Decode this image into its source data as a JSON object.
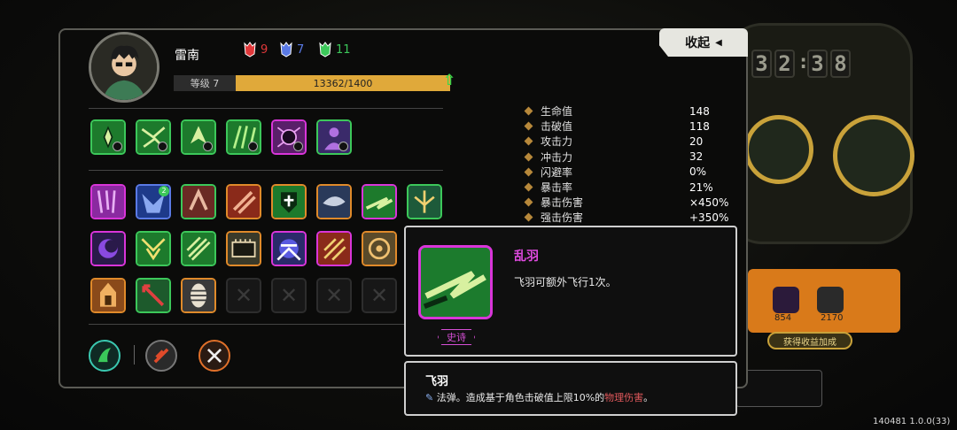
{
  "header": {
    "collapse_label": "收起",
    "character_name": "雷南",
    "level_label": "等级 7",
    "xp_text": "13362/1400",
    "xp_fill": 1.0,
    "masks": [
      {
        "icon": "red-mask-icon",
        "count": "9",
        "color": "#e0383a"
      },
      {
        "icon": "blue-mask-icon",
        "count": "7",
        "color": "#5a7ae6"
      },
      {
        "icon": "green-mask-icon",
        "count": "11",
        "color": "#3cc85a"
      }
    ]
  },
  "clock": {
    "digits": [
      "3",
      "2",
      "3",
      "8"
    ]
  },
  "stats": [
    {
      "label": "生命值",
      "value": "148"
    },
    {
      "label": "击破值",
      "value": "118"
    },
    {
      "label": "攻击力",
      "value": "20"
    },
    {
      "label": "冲击力",
      "value": "32"
    },
    {
      "label": "闪避率",
      "value": "0%"
    },
    {
      "label": "暴击率",
      "value": "21%"
    },
    {
      "label": "暴击伤害",
      "value": "×450%"
    },
    {
      "label": "强击伤害",
      "value": "+350%"
    }
  ],
  "popup": {
    "title": "乱羽",
    "description": "飞羽可额外飞行1次。",
    "rarity": "史诗",
    "title_color": "#e04ae0"
  },
  "subpopup": {
    "title": "飞羽",
    "desc_prefix": "法弹。造成基于角色击破值上限10%的",
    "desc_highlight": "物理伤害",
    "desc_suffix": "。"
  },
  "orange_panel": {
    "values": [
      "854",
      "2170"
    ],
    "bonus_label": "获得收益加成"
  },
  "version": "140481 1.0.0(33)",
  "colors": {
    "accent_gold": "#e0a93a",
    "epic_purple": "#d935d9",
    "uncommon_green": "#3cc85a",
    "rare_orange": "#e08a2a"
  }
}
